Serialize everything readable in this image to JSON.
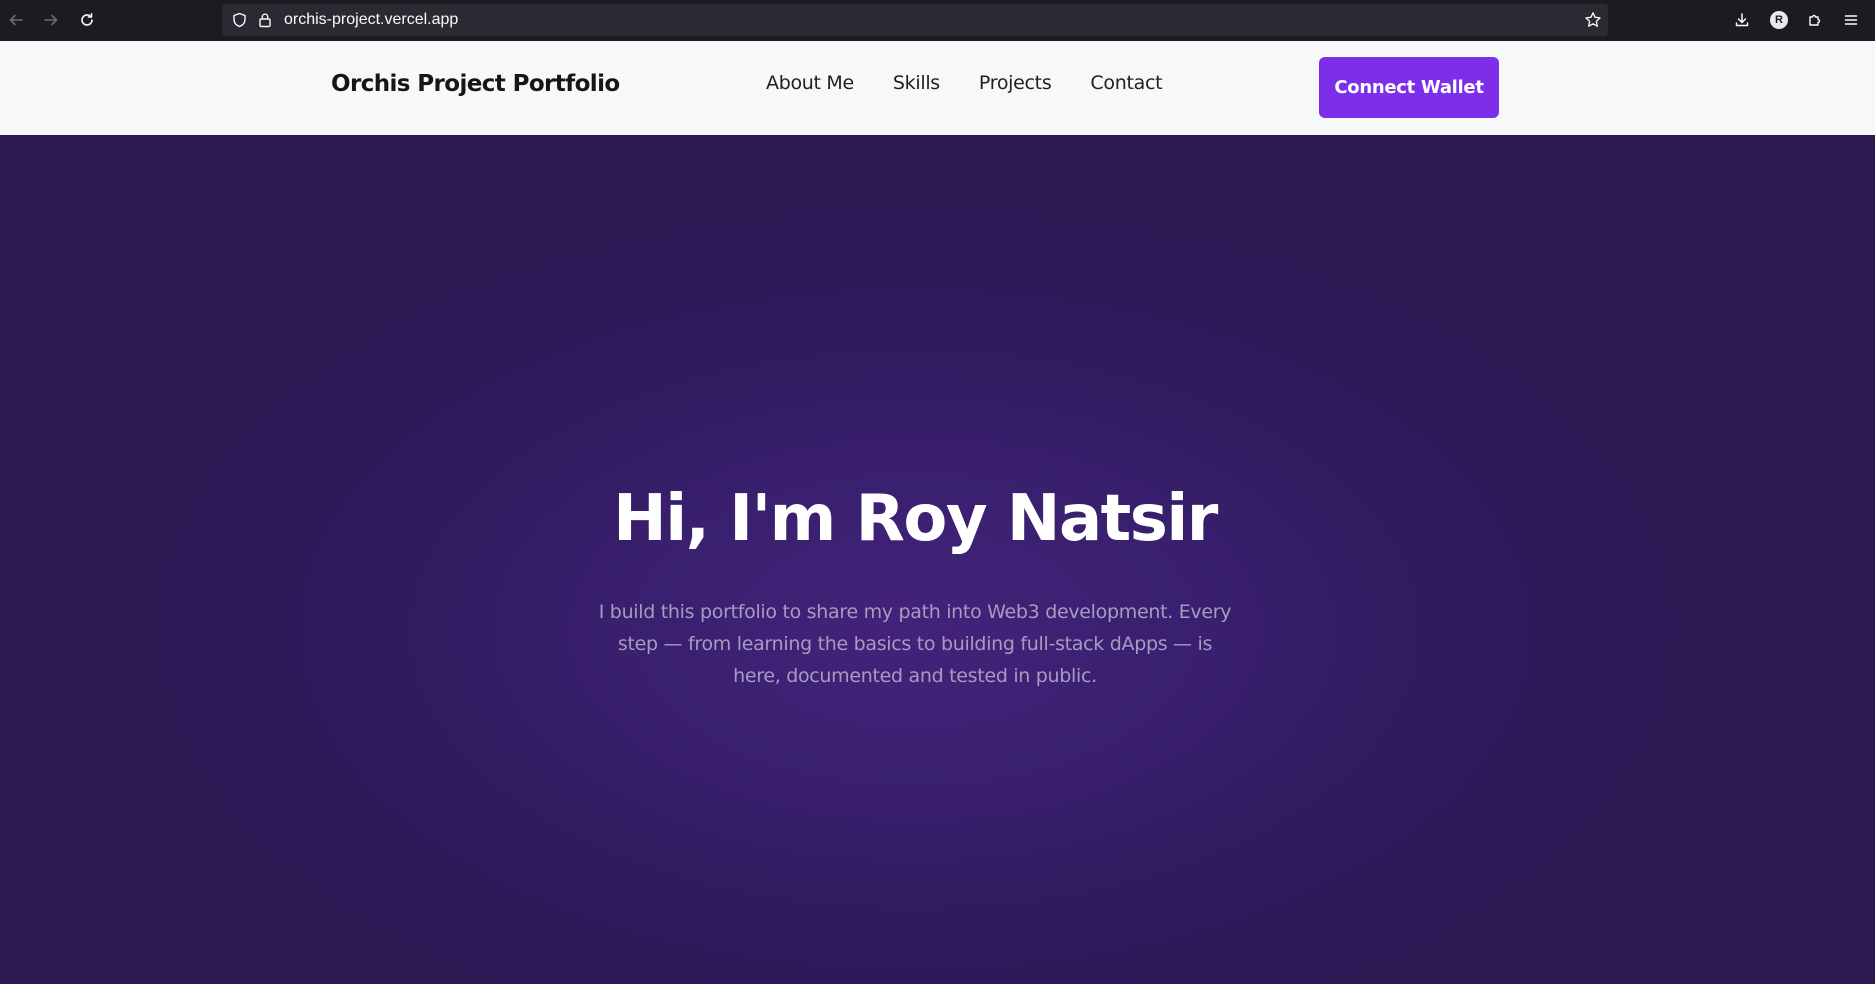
{
  "browser": {
    "url": "orchis-project.vercel.app",
    "profile_initial": "R"
  },
  "header": {
    "brand": "Orchis Project Portfolio",
    "nav": [
      {
        "label": "About Me"
      },
      {
        "label": "Skills"
      },
      {
        "label": "Projects"
      },
      {
        "label": "Contact"
      }
    ],
    "cta_label": "Connect Wallet"
  },
  "hero": {
    "title": "Hi, I'm Roy Natsir",
    "description": "I build this portfolio to share my path into Web3 development. Every step — from learning the basics to building full-stack dApps — is here, documented and tested in public."
  },
  "colors": {
    "accent": "#7c2eea",
    "hero_background": "#2c1853",
    "hero_glow": "#43237a",
    "header_background": "#f7f8fa",
    "hero_text": "#a69cbf"
  }
}
